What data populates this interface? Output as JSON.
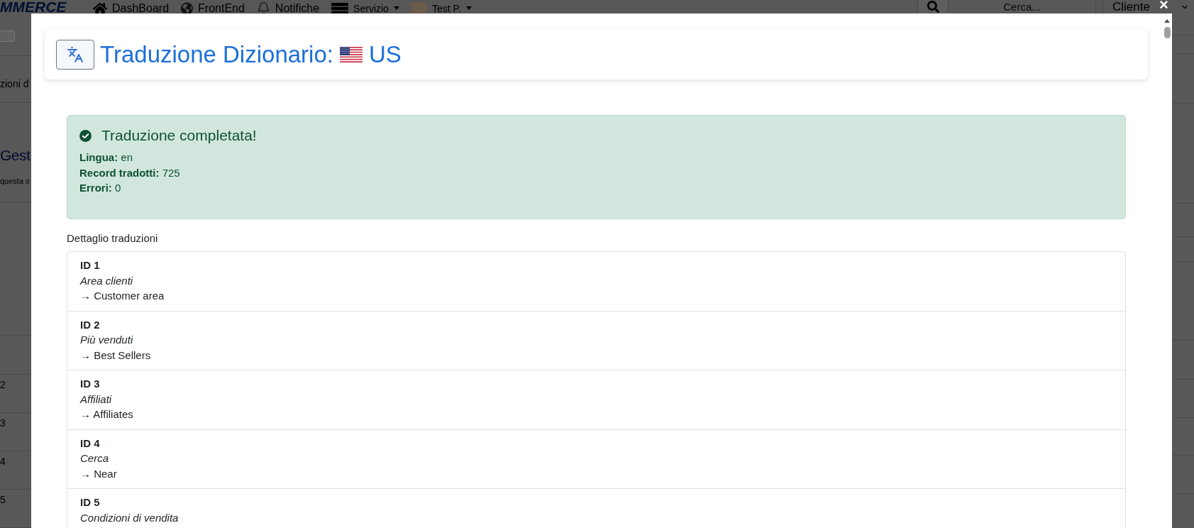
{
  "page": {
    "navbar": {
      "logo": "MMERCE",
      "links": [
        {
          "kind": "home",
          "label": "DashBoard",
          "dropdown": false
        },
        {
          "kind": "globe",
          "label": "FrontEnd",
          "dropdown": false
        },
        {
          "kind": "bell",
          "label": "Notifiche",
          "dropdown": false
        },
        {
          "kind": "server",
          "label": "Servizio",
          "dropdown": true
        },
        {
          "kind": "user",
          "label": "Test P.",
          "dropdown": true
        }
      ],
      "search": {
        "placeholder": "Cerca..."
      },
      "select": {
        "value": "Cliente"
      }
    },
    "breadcrumb": "zioni d",
    "heading": "Gest",
    "subheading": "questa s",
    "table_rows": [
      {
        "column_1": "2"
      },
      {
        "column_1": "3"
      },
      {
        "column_1": "4"
      },
      {
        "column_1": "5"
      }
    ]
  },
  "modal": {
    "close": "×",
    "title": "Traduzione Dizionario:",
    "flag_label": "US",
    "alert": {
      "heading": "Traduzione completata!",
      "lines": [
        "**Lingua:** en",
        "**Record tradotti:** 725",
        "**Errori:** 0"
      ]
    },
    "details_title": "Dettaglio traduzioni",
    "items": [
      {
        "id": "ID 1",
        "source": "Area clienti",
        "target": "→ Customer area"
      },
      {
        "id": "ID 2",
        "source": "Più venduti",
        "target": "→ Best Sellers"
      },
      {
        "id": "ID 3",
        "source": "Affiliati",
        "target": "→ Affiliates"
      },
      {
        "id": "ID 4",
        "source": "Cerca",
        "target": "→ Near"
      },
      {
        "id": "ID 5",
        "source": "Condizioni di vendita"
      }
    ]
  }
}
